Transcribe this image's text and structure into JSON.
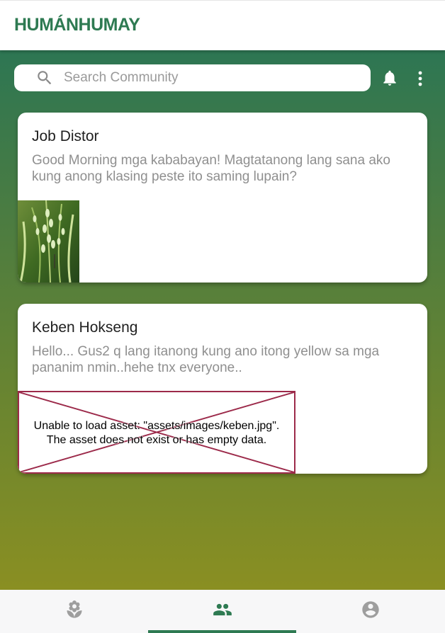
{
  "app": {
    "title": "HUMÁNHUMAY"
  },
  "search": {
    "placeholder": "Search Community",
    "value": ""
  },
  "header_icons": [
    "notifications-bell",
    "more-vert"
  ],
  "posts": [
    {
      "author": "Job Distor",
      "text": "Good Morning mga kababayan! Magtatanong lang sana ako kung anong klasing peste ito saming lupain?",
      "image": "rice-plant-photo"
    },
    {
      "author": "Keben Hokseng",
      "text": "Hello... Gus2 q lang itanong kung ano itong yellow sa mga pananim nmin..hehe tnx everyone..",
      "image_error": "Unable to load asset: \"assets/images/keben.jpg\".\nThe asset does not exist or has empty data."
    }
  ],
  "bottom_nav": {
    "items": [
      "plant-icon",
      "community-icon",
      "account-icon"
    ],
    "active": "community"
  },
  "colors": {
    "brand": "#2e7a52",
    "gradient_top": "#2d7653",
    "gradient_bottom": "#8a8f22",
    "muted_text": "#8f8f8f",
    "error_border": "#9c2a4a",
    "inactive_icon": "#9e9e9e"
  }
}
